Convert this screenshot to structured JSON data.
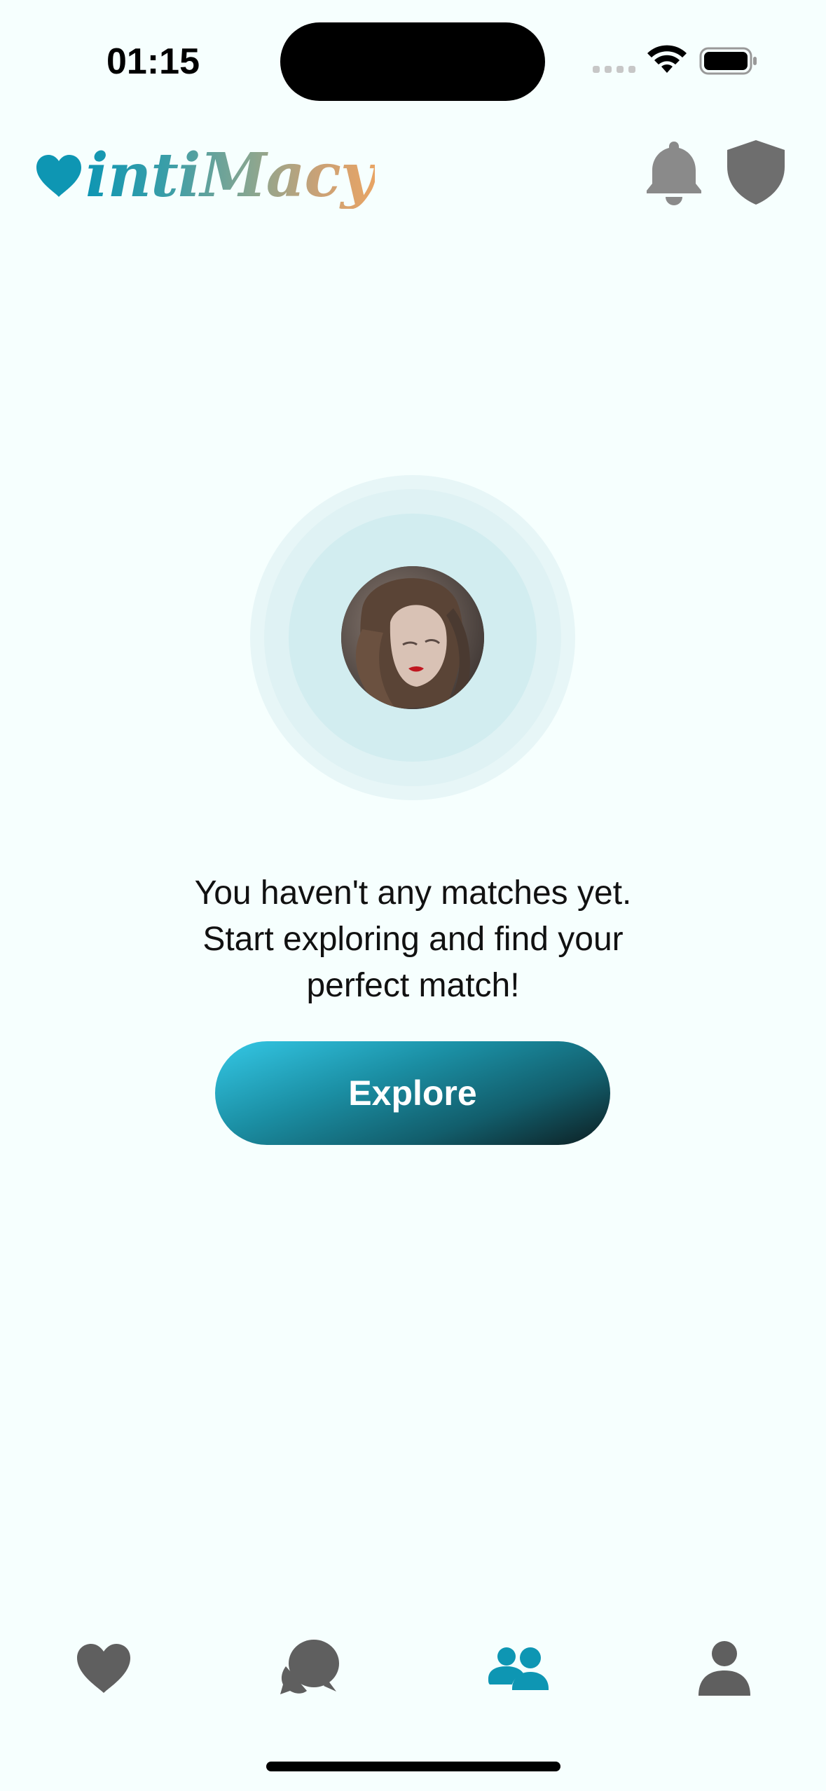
{
  "status_bar": {
    "time": "01:15",
    "icons": [
      "cellular-signal-icon",
      "wifi-icon",
      "battery-icon"
    ]
  },
  "header": {
    "logo_text": "intiMacy",
    "icons": [
      "bell-icon",
      "shield-icon"
    ]
  },
  "empty_state": {
    "message_line1": "You haven't any matches yet.",
    "message_line2": "Start exploring and find your perfect match!",
    "explore_label": "Explore"
  },
  "tab_bar": {
    "tabs": [
      {
        "icon": "heart-icon",
        "active": false
      },
      {
        "icon": "chat-bubbles-icon",
        "active": false
      },
      {
        "icon": "matches-people-icon",
        "active": true
      },
      {
        "icon": "profile-person-icon",
        "active": false
      }
    ]
  },
  "colors": {
    "background": "#f6fffe",
    "accent": "#0e96b3",
    "icon_inactive": "#5f5f5f",
    "icon_header": "#8a8a8a"
  }
}
